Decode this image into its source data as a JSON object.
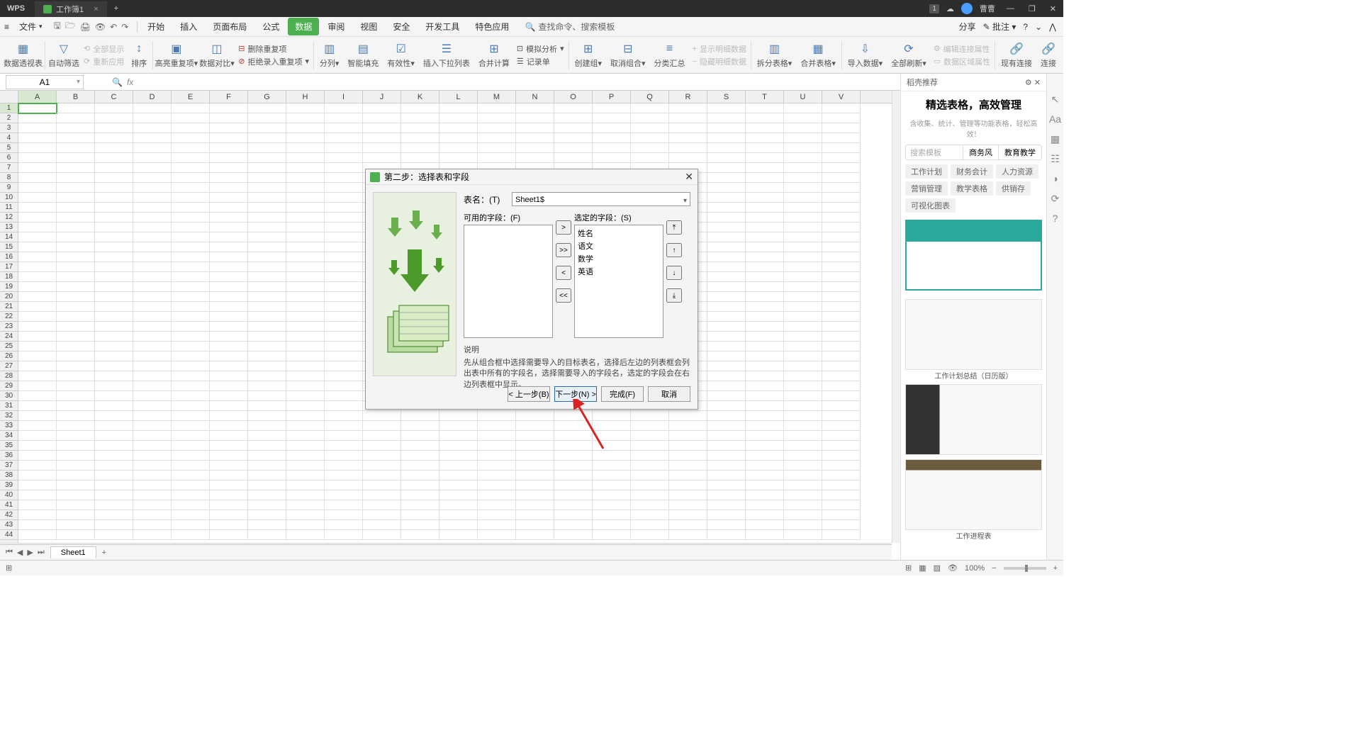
{
  "titlebar": {
    "app": "WPS",
    "tab_name": "工作簿1",
    "username": "曹曹"
  },
  "menubar": {
    "file": "文件",
    "tabs": [
      "开始",
      "插入",
      "页面布局",
      "公式",
      "数据",
      "审阅",
      "视图",
      "安全",
      "开发工具",
      "特色应用"
    ],
    "active_tab_index": 4,
    "search_placeholder": "查找命令、搜索模板",
    "share": "分享",
    "comments": "批注"
  },
  "ribbon": {
    "groups": [
      {
        "label": "数据透视表"
      },
      {
        "label": "自动筛选"
      },
      {
        "label": "排序"
      },
      {
        "label": "高亮重复项"
      },
      {
        "label": "数据对比"
      },
      {
        "label": "分列"
      },
      {
        "label": "智能填充"
      },
      {
        "label": "有效性"
      },
      {
        "label": "插入下拉列表"
      },
      {
        "label": "合并计算"
      },
      {
        "label": "记录单"
      },
      {
        "label": "创建组"
      },
      {
        "label": "取消组合"
      },
      {
        "label": "分类汇总"
      },
      {
        "label": "拆分表格"
      },
      {
        "label": "合并表格"
      },
      {
        "label": "导入数据"
      },
      {
        "label": "全部刷新"
      },
      {
        "label": "现有连接"
      },
      {
        "label": "连接"
      }
    ],
    "small_items": {
      "show_all": "全部显示",
      "reapply": "重新应用",
      "remove_dup": "删除重复项",
      "reject_dup": "拒绝录入重复项",
      "sim_analysis": "模拟分析",
      "show_detail": "显示明细数据",
      "hide_detail": "隐藏明细数据",
      "edit_conn": "编辑连接属性",
      "data_range": "数据区域属性"
    }
  },
  "formula_bar": {
    "cell_ref": "A1",
    "fx": "fx"
  },
  "columns": [
    "A",
    "B",
    "C",
    "D",
    "E",
    "F",
    "G",
    "H",
    "I",
    "J",
    "K",
    "L",
    "M",
    "N",
    "O",
    "P",
    "Q",
    "R",
    "S",
    "T",
    "U",
    "V"
  ],
  "sheet_tabs": {
    "active": "Sheet1"
  },
  "sidebar": {
    "header": "稻壳推荐",
    "title": "精选表格，高效管理",
    "subtitle": "含收集、统计、管理等功能表格，轻松高效！",
    "search_placeholder": "搜索模板",
    "search_cats": [
      "商务风",
      "教育教学"
    ],
    "filters": [
      "工作计划",
      "财务会计",
      "人力资源",
      "营销管理",
      "教学表格",
      "供销存",
      "可视化图表"
    ],
    "template_labels": [
      "",
      "工作计划总结（日历版）",
      "",
      "工作进程表"
    ]
  },
  "dialog": {
    "title": "第二步：选择表和字段",
    "table_label": "表名：(T)",
    "table_value": "Sheet1$",
    "available_label": "可用的字段：(F)",
    "selected_label": "选定的字段：(S)",
    "selected_items": [
      "姓名",
      "语文",
      "数学",
      "英语"
    ],
    "desc_title": "说明",
    "desc_text": "先从组合框中选择需要导入的目标表名，选择后左边的列表框会列出表中所有的字段名，选择需要导入的字段名，选定的字段会在右边列表框中显示。",
    "btn_prev": "< 上一步(B)",
    "btn_next": "下一步(N) >",
    "btn_finish": "完成(F)",
    "btn_cancel": "取消"
  },
  "status": {
    "zoom": "100%"
  }
}
